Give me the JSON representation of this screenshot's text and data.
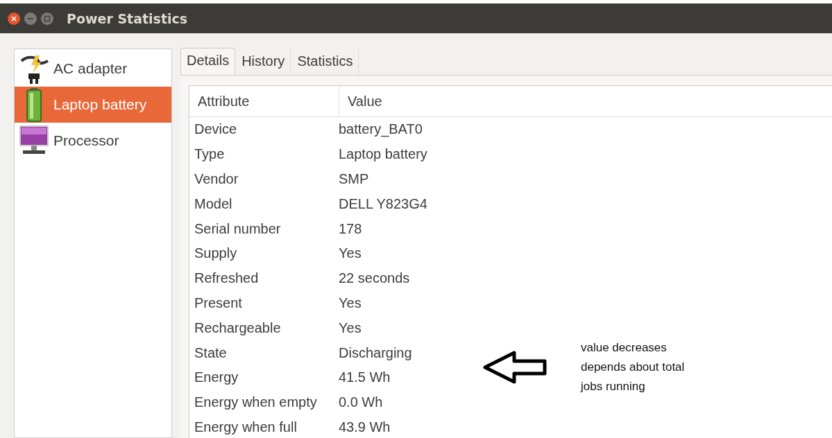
{
  "window": {
    "title": "Power Statistics"
  },
  "sidebar": {
    "items": [
      {
        "label": "AC adapter",
        "kind": "adapter",
        "selected": false
      },
      {
        "label": "Laptop battery",
        "kind": "battery",
        "selected": true
      },
      {
        "label": "Processor",
        "kind": "monitor",
        "selected": false
      }
    ]
  },
  "tabs": [
    {
      "label": "Details",
      "selected": true
    },
    {
      "label": "History",
      "selected": false
    },
    {
      "label": "Statistics",
      "selected": false
    }
  ],
  "table": {
    "columns": [
      "Attribute",
      "Value"
    ],
    "rows": [
      [
        "Device",
        "battery_BAT0"
      ],
      [
        "Type",
        "Laptop battery"
      ],
      [
        "Vendor",
        "SMP"
      ],
      [
        "Model",
        "DELL Y823G4"
      ],
      [
        "Serial number",
        "178"
      ],
      [
        "Supply",
        "Yes"
      ],
      [
        "Refreshed",
        "22 seconds"
      ],
      [
        "Present",
        "Yes"
      ],
      [
        "Rechargeable",
        "Yes"
      ],
      [
        "State",
        "Discharging"
      ],
      [
        "Energy",
        "41.5 Wh"
      ],
      [
        "Energy when empty",
        "0.0 Wh"
      ],
      [
        "Energy when full",
        "43.9 Wh"
      ]
    ]
  },
  "annotation": {
    "lines": [
      "value decreases",
      "depends about total",
      "jobs running"
    ]
  }
}
